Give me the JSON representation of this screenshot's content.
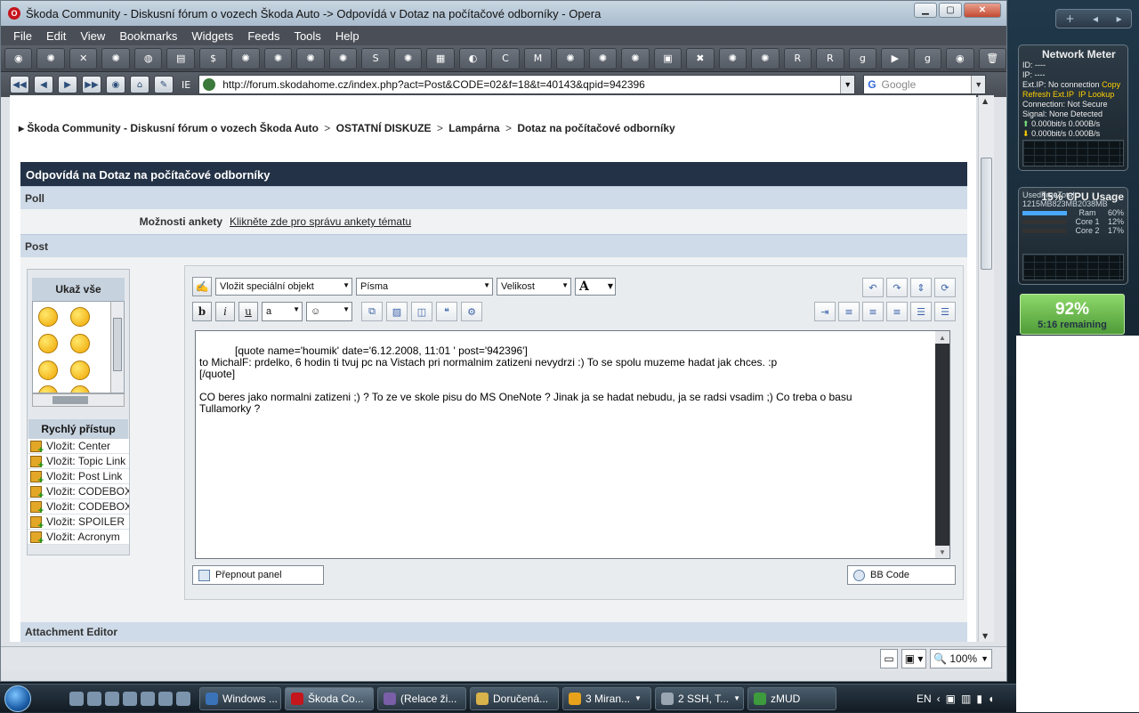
{
  "window": {
    "title": "Škoda Community - Diskusní fórum o vozech Škoda Auto -> Odpovídá v Dotaz na počítačové odborníky - Opera"
  },
  "menu": [
    "File",
    "Edit",
    "View",
    "Bookmarks",
    "Widgets",
    "Feeds",
    "Tools",
    "Help"
  ],
  "addressbar": {
    "ie_label": "IE",
    "url": "http://forum.skodahome.cz/index.php?act=Post&CODE=02&f=18&t=40143&qpid=942396",
    "search_placeholder": "Google"
  },
  "breadcrumb": {
    "items": [
      "Škoda Community - Diskusní fórum o vozech Škoda Auto",
      "OSTATNÍ DISKUZE",
      "Lampárna",
      "Dotaz na počítačové odborníky"
    ],
    "sep": ">"
  },
  "form": {
    "header": "Odpovídá na Dotaz na počítačové odborníky",
    "poll_section": "Poll",
    "poll_label": "Možnosti ankety",
    "poll_link": "Klikněte zde pro správu ankety tématu",
    "post_section": "Post",
    "attachment_section": "Attachment Editor"
  },
  "sidebar": {
    "smilies_title": "Ukaž vše",
    "quick_title": "Rychlý přístup",
    "quick_items": [
      "Vložit: Center",
      "Vložit: Topic Link",
      "Vložit: Post Link",
      "Vložit: CODEBOX",
      "Vložit: CODEBOX",
      "Vložit: SPOILER",
      "Vložit: Acronym"
    ]
  },
  "editor": {
    "special_select": "Vložit speciální objekt",
    "font_select": "Písma",
    "size_select": "Velikost",
    "font_color": "A",
    "text": "[quote name='houmik' date='6.12.2008, 11:01 ' post='942396']\nto MichalF: prdelko, 6 hodin ti tvuj pc na Vistach pri normalnim zatizeni nevydrzi :) To se spolu muzeme hadat jak chces. :p\n[/quote]\n\nCO beres jako normalni zatizeni ;) ? To ze ve skole pisu do MS OneNote ? Jinak ja se hadat nebudu, ja se radsi vsadim ;) Co treba o basu\nTullamorky ?",
    "switch_panel": "Přepnout panel",
    "bbcode": "BB Code"
  },
  "status": {
    "zoom": "100%"
  },
  "gadgets": {
    "network": {
      "title": "Network Meter",
      "id": "ID: ----",
      "ip": "IP: ----",
      "ext_ip": "Ext.IP: No connection",
      "copy": "Copy",
      "refresh": "Refresh Ext.IP",
      "lookup": "IP Lookup",
      "connection": "Connection: Not Secure",
      "signal": "Signal: None Detected",
      "up": "0.000bit/s    0.000B/s",
      "down": "0.000bit/s    0.000B/s"
    },
    "cpu": {
      "title": "CPU Usage",
      "percent": "15%",
      "headers": [
        "Used",
        "Free",
        "Total"
      ],
      "values": [
        "1215MB",
        "823MB",
        "2038MB"
      ],
      "ram": "Ram",
      "ram_pct": "60%",
      "core1": "Core 1",
      "core1_pct": "12%",
      "core2": "Core 2",
      "core2_pct": "17%"
    },
    "battery": {
      "percent": "92%",
      "remaining": "5:16 remaining"
    }
  },
  "taskbar": {
    "tasks": [
      "Windows ...",
      "Škoda Co...",
      "(Relace ži...",
      "Doručená...",
      "3 Miran...",
      "2 SSH, T...",
      "zMUD"
    ],
    "lang": "EN"
  },
  "colors": {
    "header_bg": "#233246",
    "section_bg": "#cfdbe8",
    "toolbar_bg": "#4a4f57"
  }
}
